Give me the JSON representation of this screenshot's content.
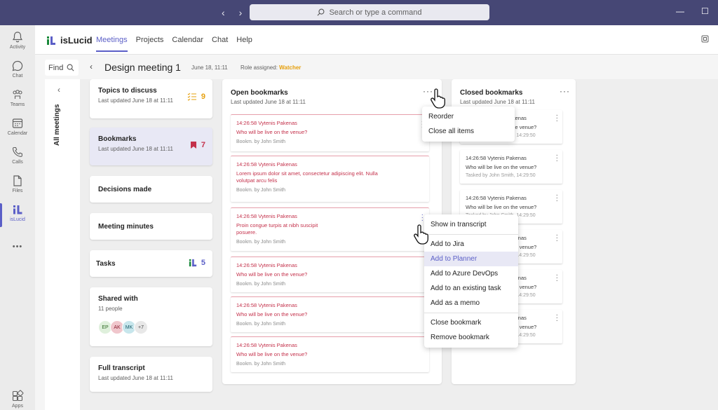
{
  "titlebar": {
    "search_placeholder": "Search or type a command",
    "nav_back": "‹",
    "nav_forward": "›",
    "minimize": "—",
    "maximize": "☐"
  },
  "rail": {
    "items": [
      {
        "label": "Activity",
        "icon": "bell-icon"
      },
      {
        "label": "Chat",
        "icon": "chat-icon"
      },
      {
        "label": "Teams",
        "icon": "teams-icon"
      },
      {
        "label": "Calendar",
        "icon": "calendar-icon"
      },
      {
        "label": "Calls",
        "icon": "phone-icon"
      },
      {
        "label": "Files",
        "icon": "file-icon"
      },
      {
        "label": "isLucid",
        "icon": "islucid-icon"
      },
      {
        "label": "Apps",
        "icon": "apps-icon"
      }
    ],
    "more": "•••"
  },
  "appbar": {
    "app_name": "isLucid",
    "tabs": [
      "Meetings",
      "Projects",
      "Calendar",
      "Chat",
      "Help"
    ],
    "active_tab": "Meetings"
  },
  "subbar": {
    "find_label": "Find",
    "meeting_title": "Design meeting 1",
    "meeting_date": "June 18, 11:11",
    "role_label": "Role assigned:",
    "role_value": "Watcher"
  },
  "side_panel": {
    "label": "All meetings"
  },
  "cards": [
    {
      "title": "Topics to discuss",
      "sub": "Last updated June 18 at 11:11",
      "count": "9",
      "icon": "checklist-icon"
    },
    {
      "title": "Bookmarks",
      "sub": "Last updated June 18 at 11:11",
      "count": "7",
      "icon": "bookmark-icon"
    },
    {
      "title": "Decisions made"
    },
    {
      "title": "Meeting minutes"
    },
    {
      "title": "Tasks",
      "count": "5",
      "icon": "islucid-icon"
    },
    {
      "title": "Shared with",
      "sub": "11 people",
      "avatars": [
        "EP",
        "AK",
        "MK",
        "+7"
      ]
    },
    {
      "title": "Full transcript",
      "sub": "Last updated June 18 at 11:11"
    }
  ],
  "open_bookmarks": {
    "title": "Open bookmarks",
    "sub": "Last updated June 18 at 11:11",
    "items": [
      {
        "head": "14:26:58 Vytenis Pakenas",
        "text": "Who will be live on the venue?",
        "foot": "Bookm. by John Smith"
      },
      {
        "head": "14:26:58 Vytenis Pakenas",
        "text": "Lorem ipsum dolor sit amet, consectetur adipiscing elit. Nulla volutpat arcu felis",
        "foot": "Bookm. by John Smith"
      },
      {
        "head": "14:26:58 Vytenis Pakenas",
        "text": "Proin congue turpis at nibh suscipit posuere.",
        "foot": "Bookm. by John Smith"
      },
      {
        "head": "14:26:58 Vytenis Pakenas",
        "text": "Who will be live on the venue?",
        "foot": "Bookm. by John Smith"
      },
      {
        "head": "14:26:58 Vytenis Pakenas",
        "text": "Who will be live on the venue?",
        "foot": "Bookm. by John Smith"
      },
      {
        "head": "14:26:58 Vytenis Pakenas",
        "text": "Who will be live on the venue?",
        "foot": "Bookm. by John Smith"
      }
    ]
  },
  "closed_bookmarks": {
    "title": "Closed bookmarks",
    "sub": "Last updated June 18 at 11:11",
    "items": [
      {
        "head": "14:26:58 Vytenis Pakenas",
        "text": "Who will be live on the venue?",
        "foot": "Tasked by John Smith, 14:29:50"
      },
      {
        "head": "14:26:58 Vytenis Pakenas",
        "text": "Who will be live on the venue?",
        "foot": "Tasked by John Smith, 14:29:50"
      },
      {
        "head": "14:26:58 Vytenis Pakenas",
        "text": "Who will be live on the venue?",
        "foot": "Tasked by John Smith, 14:29:50"
      },
      {
        "head": "14:26:58 Vytenis Pakenas",
        "text": "Who will be live on the venue?",
        "foot": "Tasked by John Smith, 14:29:50"
      },
      {
        "head": "14:26:58 Vytenis Pakenas",
        "text": "Who will be live on the venue?",
        "foot": "Tasked by John Smith, 14:29:50"
      },
      {
        "head": "14:26:58 Vytenis Pakenas",
        "text": "Who will be live on the venue?",
        "foot": "Tasked by John Smith, 14:29:50"
      }
    ]
  },
  "column_menu": {
    "items": [
      "Reorder",
      "Close all items"
    ]
  },
  "item_menu": {
    "items": [
      "Show in transcript",
      "Add to Jira",
      "Add to Planner",
      "Add to Azure DevOps",
      "Add to an existing task",
      "Add as a memo",
      "Close bookmark",
      "Remove bookmark"
    ],
    "hovered": "Add to Planner"
  },
  "colors": {
    "titlebar": "#464775",
    "accent": "#5b5fc7",
    "bookmark_red": "#c4314b",
    "watcher": "#e6a00e"
  }
}
